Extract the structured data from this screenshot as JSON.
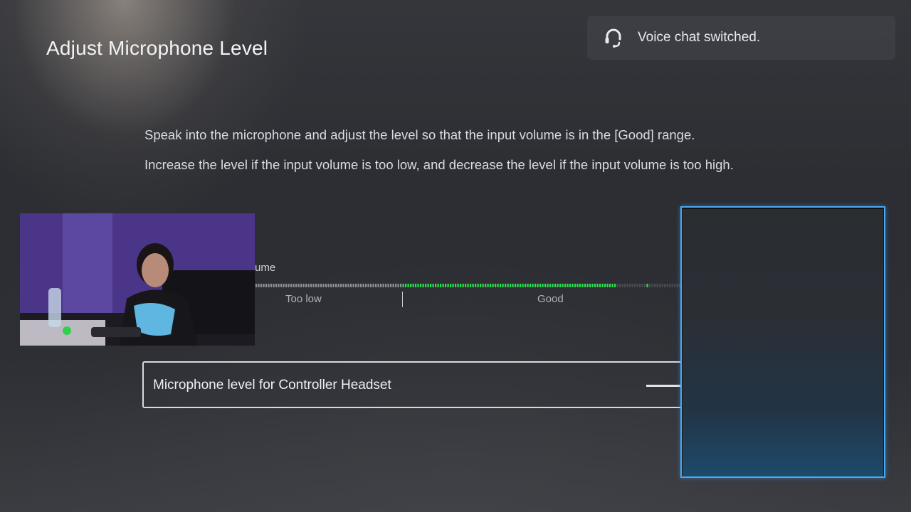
{
  "page": {
    "title": "Adjust Microphone Level"
  },
  "toast": {
    "icon": "headset-icon",
    "text": "Voice chat switched."
  },
  "instructions": {
    "line1": "Speak into the microphone and adjust the level so that the input volume is in the [Good] range.",
    "line2": "Increase the level if the input volume is too low, and decrease the level if the input volume is too high."
  },
  "meter": {
    "label": "ume",
    "zones": {
      "low": "Too low",
      "good": "Good"
    },
    "active_color": "#2ee04f",
    "inactive_color": "#8e9298"
  },
  "mic_level": {
    "label": "Microphone level for Controller Headset"
  },
  "colors": {
    "focus_border": "#4aa8f0",
    "background": "#2d2f34"
  }
}
